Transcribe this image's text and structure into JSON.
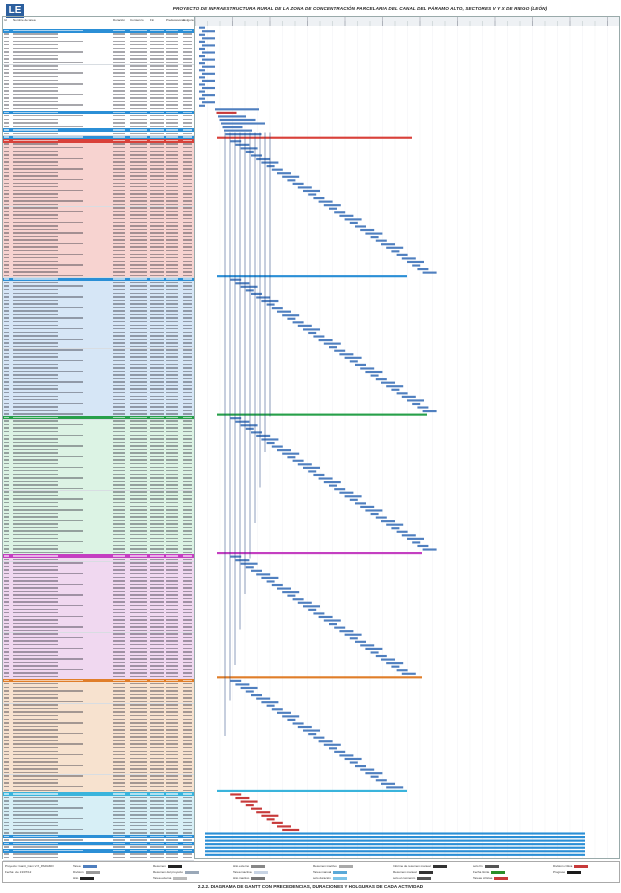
{
  "header": {
    "logo_text": "LE",
    "title": "PROYECTO DE INFRAESTRUCTURA RURAL DE LA ZONA DE CONCENTRACIÓN PARCELARIA DEL CANAL DEL PÁRAMO ALTO, SECTORES V Y X DE RIEGO (LEÓN)"
  },
  "columns": [
    "Id",
    "Nombre de tarea",
    "Duración",
    "Comienzo",
    "Fin",
    "Predecesoras",
    "Holgura total"
  ],
  "colors": {
    "section_blue": "#2b8fd6",
    "band_red": "#f7d3d0",
    "band_blue": "#d6e6f6",
    "band_green": "#dcf3e4",
    "band_magenta": "#f0d8f0",
    "band_orange": "#f7e2cf",
    "band_cyan": "#d7eff6",
    "header_red": "#d9413a",
    "header_green": "#27a04a",
    "header_magenta": "#c43fc1",
    "header_orange": "#e07e2a",
    "header_cyan": "#3ab4dc",
    "bar_blue": "#4f7fbf",
    "bar_red": "#c73a3a",
    "link_line": "#1f3f7a"
  },
  "caption": "2.2.2.  DIAGRAMA DE GANTT CON PRECEDENCIAS, DURACIONES Y HOLGURAS DE CADA ACTIVIDAD",
  "legend": {
    "project": "Proyecto: Gantt_Cam.V.X_PARAMO",
    "date": "Fecha: vie 13/07/12",
    "items": [
      {
        "label": "Tarea",
        "color": "#4f7fbf"
      },
      {
        "label": "División",
        "color": "#999999"
      },
      {
        "label": "Hito",
        "color": "#222222"
      },
      {
        "label": "Resumen",
        "color": "#222222"
      },
      {
        "label": "Resumen del proyecto",
        "color": "#9aa8b8"
      },
      {
        "label": "Tarea externa",
        "color": "#bbbbbb"
      },
      {
        "label": "Hito externo",
        "color": "#888888"
      },
      {
        "label": "Tarea inactiva",
        "color": "#c8d4e4"
      },
      {
        "label": "Hito inactivo",
        "color": "#777777"
      },
      {
        "label": "Resumen inactivo",
        "color": "#aaaaaa"
      },
      {
        "label": "Tarea manual",
        "color": "#5aa9d8"
      },
      {
        "label": "solo duración",
        "color": "#7dc4e8"
      },
      {
        "label": "Informe de resumen manual",
        "color": "#333333"
      },
      {
        "label": "Resumen manual",
        "color": "#333333"
      },
      {
        "label": "solo el comienzo",
        "color": "#555555"
      },
      {
        "label": "solo fin",
        "color": "#555555"
      },
      {
        "label": "Fecha límite",
        "color": "#2a8f2a"
      },
      {
        "label": "Tareas críticas",
        "color": "#c73a3a"
      },
      {
        "label": "División crítica",
        "color": "#c73a3a"
      },
      {
        "label": "Progreso",
        "color": "#1a1a1a"
      }
    ]
  }
}
